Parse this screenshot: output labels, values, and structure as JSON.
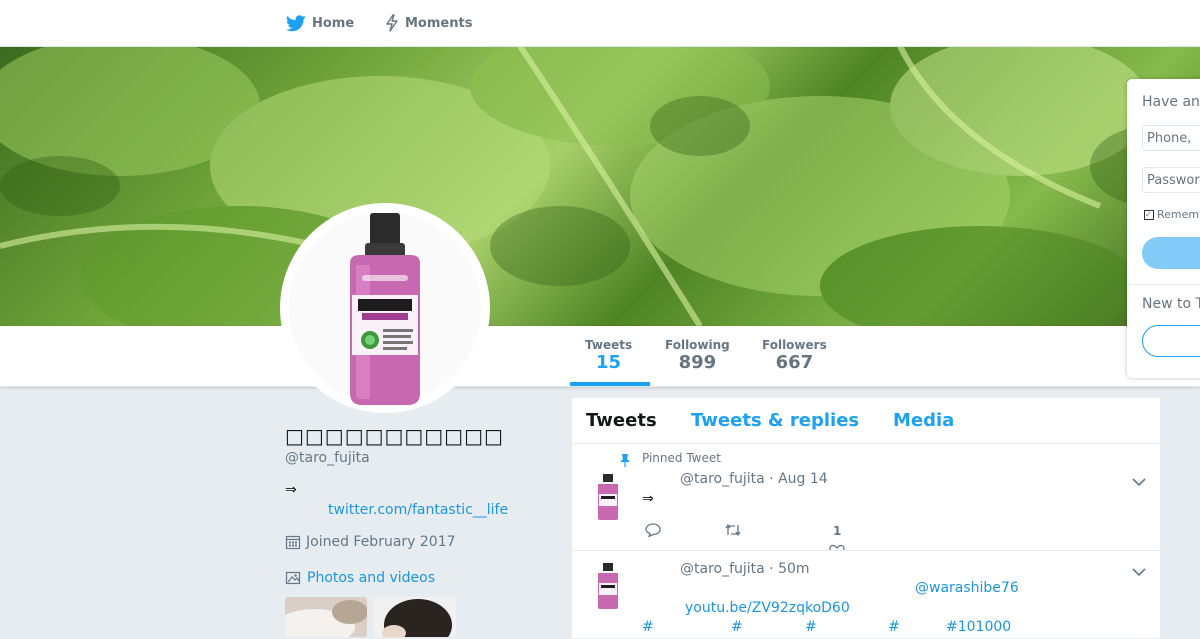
{
  "nav": {
    "home_label": "Home",
    "moments_label": "Moments"
  },
  "profile": {
    "name": "□□□□□□□□□□□",
    "handle": "@taro_fujita",
    "bio": "⇒",
    "link": "twitter.com/fantastic__life",
    "joined": "Joined February 2017",
    "photos_label": "Photos and videos"
  },
  "stats": [
    {
      "label": "Tweets",
      "value": "15"
    },
    {
      "label": "Following",
      "value": "899"
    },
    {
      "label": "Followers",
      "value": "667"
    }
  ],
  "timeline": {
    "tabs": [
      "Tweets",
      "Tweets & replies",
      "Media"
    ],
    "tweets": [
      {
        "pinned_label": "Pinned Tweet",
        "meta": "@taro_fujita · Aug 14",
        "text": "⇒",
        "like_count": "1"
      },
      {
        "meta": "@taro_fujita · 50m",
        "mention": "@warashibe76",
        "link": "youtu.be/ZV92zqkoD60",
        "hashtags": [
          "#",
          "#",
          "#",
          "#",
          "#101000"
        ]
      }
    ]
  },
  "login": {
    "title": "Have an",
    "phone_placeholder": "Phone,",
    "password_placeholder": "Passwor",
    "remember_label": "Remem",
    "new_label": "New to T"
  },
  "colors": {
    "accent": "#1da1f2",
    "link": "#1b95e0",
    "background": "#e6ecf0",
    "mouthwash_purple": "#c768b0"
  },
  "icons": {
    "home": "bird-icon",
    "moments": "lightning-icon",
    "pin": "pin-icon",
    "calendar": "calendar-icon",
    "photos": "image-icon",
    "reply": "reply-icon",
    "retweet": "retweet-icon",
    "like": "heart-icon",
    "caret": "chevron-down-icon"
  }
}
